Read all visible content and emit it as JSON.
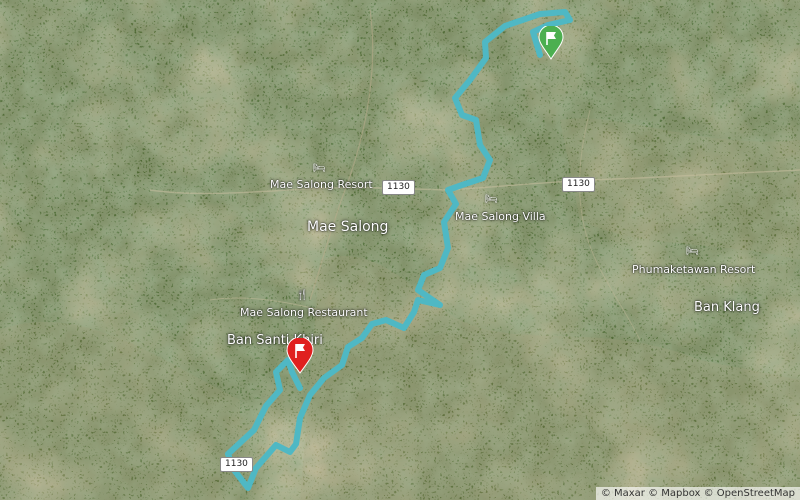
{
  "map": {
    "places": {
      "mae_salong": "Mae Salong",
      "ban_santi_khiri": "Ban Santi Khiri",
      "ban_klang": "Ban Klang"
    },
    "pois": {
      "mae_salong_resort": "Mae Salong Resort",
      "mae_salong_villa": "Mae Salong Villa",
      "phumaketawan_resort": "Phumaketawan Resort",
      "mae_salong_restaurant": "Mae Salong Restaurant"
    },
    "road_shields": {
      "upper_left": "1130",
      "upper_right": "1130",
      "lower_left": "1130"
    },
    "attribution": "© Maxar © Mapbox © OpenStreetMap",
    "colors": {
      "route": "#4fb8c4",
      "start_marker": "#4caf50",
      "end_marker": "#e0201f"
    },
    "icons": {
      "hotel": "bed-icon",
      "restaurant": "fork-knife-icon",
      "start": "green-flag-pin-icon",
      "end": "red-flag-pin-icon"
    }
  }
}
